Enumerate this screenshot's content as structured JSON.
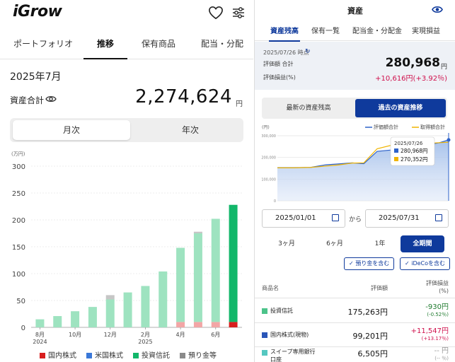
{
  "left": {
    "app_name": "iGrow",
    "tabs": [
      {
        "label": "ポートフォリオ"
      },
      {
        "label": "推移"
      },
      {
        "label": "保有商品"
      },
      {
        "label": "配当・分配"
      }
    ],
    "year_month": "2025年7月",
    "total_label": "資産合計",
    "total_value": "2,274,624",
    "total_unit": "円",
    "segment": [
      "月次",
      "年次"
    ],
    "legend": [
      {
        "label": "国内株式",
        "color": "#d81e1e"
      },
      {
        "label": "米国株式",
        "color": "#3a78d8"
      },
      {
        "label": "投資信託",
        "color": "#12b76a"
      },
      {
        "label": "預り金等",
        "color": "#8a8a8a"
      }
    ]
  },
  "right": {
    "title": "資産",
    "tabs": [
      {
        "label": "資産残高"
      },
      {
        "label": "保有一覧"
      },
      {
        "label": "配当金・分配金"
      },
      {
        "label": "実現損益"
      }
    ],
    "as_of": "2025/07/26 時点",
    "refresh_icon": "↻",
    "eval_label": "評価額 合計",
    "eval_value": "280,968",
    "eval_unit": "円",
    "pl_label": "評価損益(%)",
    "pl_value": "+10,616円(+3.92％)",
    "toggle": [
      "最新の資産残高",
      "過去の資産推移"
    ],
    "date_from": "2025/01/01",
    "date_sep": "から",
    "date_to": "2025/07/31",
    "periods": [
      "3ヶ月",
      "6ヶ月",
      "1年",
      "全期間"
    ],
    "checks": [
      "✓ 預り金を含む",
      "✓ iDeCoを含む"
    ],
    "table_headers": {
      "name": "商品名",
      "value": "評価額",
      "pl": "評価損益",
      "pl_unit": "(%)"
    },
    "rows": [
      {
        "name": "投資信託",
        "color": "#4cc38a",
        "value": "175,263円",
        "pl": "-930円",
        "pct": "(-0.52％)",
        "sign": "neg"
      },
      {
        "name": "国内株式(現物)",
        "color": "#2a56b8",
        "value": "99,201円",
        "pl": "+11,547円",
        "pct": "(+13.17％)",
        "sign": "pos"
      },
      {
        "name": "スイープ専用銀行\n口座",
        "color": "#55c7c0",
        "value": "6,505円",
        "pl": "-- 円",
        "pct": "(-- ％)",
        "sign": "muted"
      }
    ]
  },
  "chart_data": [
    {
      "type": "bar",
      "stacked": true,
      "ylabel": "(万円)",
      "ylim": [
        0,
        300
      ],
      "yticks": [
        0,
        50,
        100,
        150,
        200,
        250,
        300
      ],
      "x_tick_labels": [
        {
          "index": 0,
          "label": "8月",
          "sub": "2024"
        },
        {
          "index": 2,
          "label": "10月",
          "sub": ""
        },
        {
          "index": 4,
          "label": "12月",
          "sub": ""
        },
        {
          "index": 6,
          "label": "2月",
          "sub": "2025"
        },
        {
          "index": 8,
          "label": "4月",
          "sub": ""
        },
        {
          "index": 10,
          "label": "6月",
          "sub": ""
        }
      ],
      "categories": [
        "2024-08",
        "2024-09",
        "2024-10",
        "2024-11",
        "2024-12",
        "2025-01",
        "2025-02",
        "2025-03",
        "2025-04",
        "2025-05",
        "2025-06",
        "2025-07"
      ],
      "series": [
        {
          "name": "国内株式",
          "color_faded": "#f2a6a6",
          "color_active": "#d81e1e",
          "values": [
            0,
            0,
            0,
            0,
            0,
            0,
            0,
            0,
            10,
            10,
            10,
            10
          ]
        },
        {
          "name": "米国株式",
          "color_faded": "#a9c5ee",
          "color_active": "#3a78d8",
          "values": [
            0,
            0,
            0,
            0,
            0,
            0,
            0,
            0,
            0,
            0,
            0,
            0
          ]
        },
        {
          "name": "投資信託",
          "color_faded": "#9ee3c0",
          "color_active": "#12b76a",
          "values": [
            15,
            21,
            30,
            38,
            52,
            65,
            77,
            104,
            138,
            165,
            192,
            218
          ]
        },
        {
          "name": "預り金等",
          "color_faded": "#c6c6c6",
          "color_active": "#8a8a8a",
          "values": [
            0,
            0,
            0,
            0,
            8,
            0,
            0,
            0,
            0,
            3,
            0,
            0
          ]
        }
      ],
      "active_index": 11
    },
    {
      "type": "line",
      "legend": [
        {
          "label": "評価額合計",
          "color": "#2e62c9"
        },
        {
          "label": "取得額合計",
          "color": "#f0b400"
        }
      ],
      "ylabel": "(円)",
      "ylim": [
        0,
        300000
      ],
      "yticks": [
        0,
        100000,
        200000,
        300000
      ],
      "ytick_labels": [
        "0",
        "100,000",
        "200,000",
        "300,000"
      ],
      "x": [
        "2025-01-01",
        "2025-01-20",
        "2025-02-10",
        "2025-02-28",
        "2025-03-15",
        "2025-04-01",
        "2025-04-15",
        "2025-05-01",
        "2025-05-20",
        "2025-06-10",
        "2025-06-30",
        "2025-07-15",
        "2025-07-26"
      ],
      "series": [
        {
          "name": "評価額合計",
          "values": [
            153000,
            153000,
            154000,
            166000,
            170000,
            175000,
            171000,
            228000,
            235000,
            246000,
            258000,
            268000,
            280968
          ]
        },
        {
          "name": "取得額合計",
          "values": [
            152000,
            152000,
            154000,
            160000,
            165000,
            174000,
            175000,
            240000,
            258000,
            262000,
            265000,
            268000,
            270352
          ]
        }
      ],
      "tooltip": {
        "date": "2025/07/26",
        "eval": "280,968円",
        "cost": "270,352円"
      }
    }
  ]
}
